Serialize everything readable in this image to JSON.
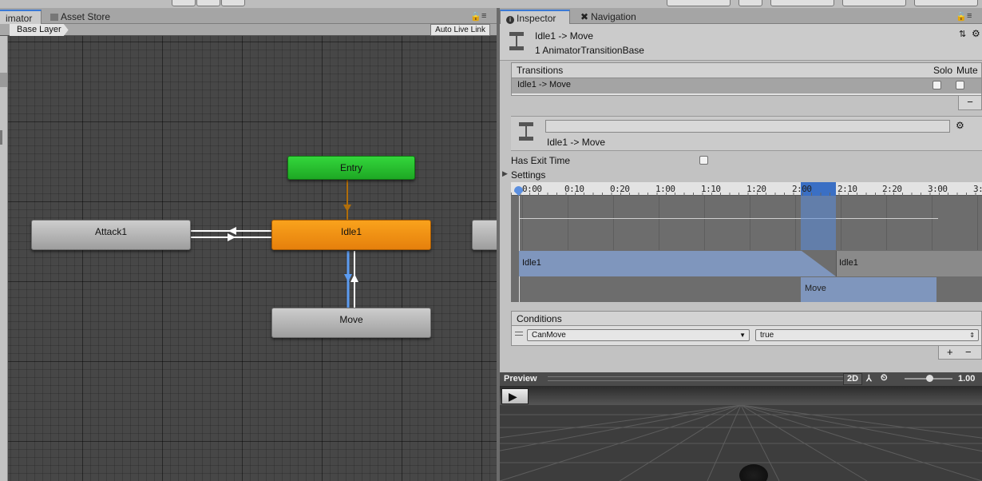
{
  "tabs_left": {
    "animator": "imator",
    "asset_store": "Asset Store"
  },
  "tabs_right": {
    "inspector": "Inspector",
    "navigation": "Navigation"
  },
  "animator": {
    "breadcrumb": "Base Layer",
    "auto_live_link": "Auto Live Link",
    "states": {
      "entry": "Entry",
      "idle1": "Idle1",
      "attack1": "Attack1",
      "move": "Move"
    }
  },
  "inspector": {
    "header_title": "Idle1 -> Move",
    "header_subtitle": "1 AnimatorTransitionBase",
    "transitions_label": "Transitions",
    "solo_label": "Solo",
    "mute_label": "Mute",
    "transition_row": "Idle1 -> Move",
    "remove_label": "−",
    "transition_name_value": "",
    "transition_caption": "Idle1 -> Move",
    "has_exit_time_label": "Has Exit Time",
    "settings_label": "Settings",
    "timeline": {
      "ticks": [
        "0:00",
        "0:10",
        "0:20",
        "1:00",
        "1:10",
        "1:20",
        "2:00",
        "2:10",
        "2:20",
        "3:00",
        "3:"
      ],
      "source_clip": "Idle1",
      "source_clip_after": "Idle1",
      "dest_clip": "Move"
    },
    "conditions_label": "Conditions",
    "condition": {
      "parameter": "CanMove",
      "value": "true"
    },
    "add_label": "+",
    "minus_label": "−"
  },
  "preview": {
    "label": "Preview",
    "mode_2d": "2D",
    "speed": "1.00",
    "play_icon": "play-icon"
  },
  "colors": {
    "state_default": "#b5b5b5",
    "state_active": "#f08c12",
    "state_entry": "#27c12e",
    "transition_selected": "#5b9bf0",
    "accent": "#3a79d6"
  }
}
